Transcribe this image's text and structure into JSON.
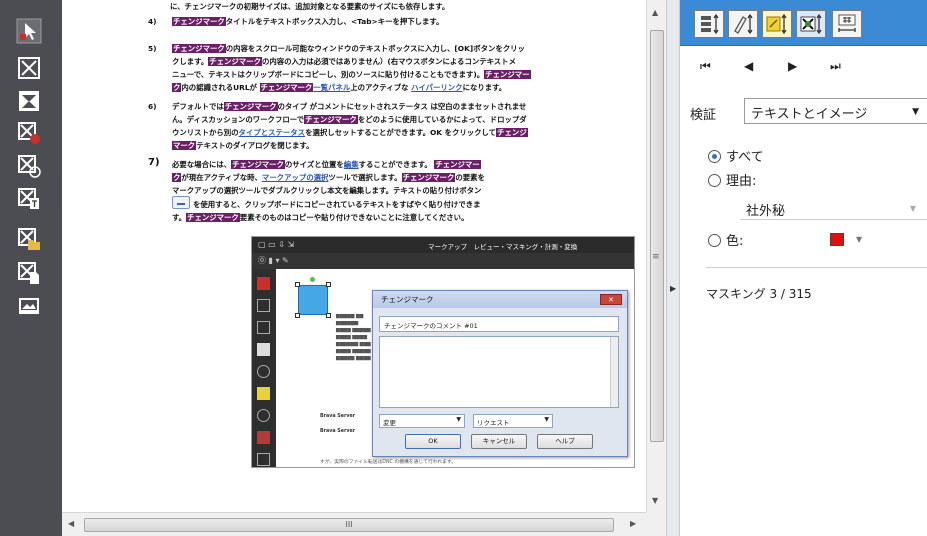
{
  "document": {
    "line_top": "に、チェンジマークの初期サイズは、追加対象となる要素のサイズにも依存します。",
    "item4": {
      "number": "4)",
      "hl": "チェンジマーク",
      "text": "タイトルをテキストボックス入力し、<Tab>キーを押下します。"
    },
    "item5": {
      "number": "5)",
      "hl1": "チェンジマーク",
      "t1": "の内容をスクロール可能なウィンドウのテキストボックスに入力し、[OK]ボタンをクリッ",
      "t2a": "クします。",
      "hl2": "チェンジマーク",
      "t2b": "の内容の入力は必須ではありません）(右マウスボタンによるコンテキストメ",
      "t3a": "ニューで、テキストはクリップボードにコピーし、別のソースに貼り付けることもできます)。",
      "hl3": "チェンジマー",
      "hl4": "ク",
      "t4a": "内の認識されるURLが",
      "hl5": "チェンジマーク",
      "lnk1": "一覧パネル",
      "t4b": "上のアクティブな",
      "lnk2": "ハイパーリンク",
      "t4c": "になります。"
    },
    "item6": {
      "number": "6)",
      "t1a": "デフォルトでは",
      "hl1": "チェンジマーク",
      "t1b": "のタイプ がコメントにセットされステータス は空白のままセットされませ",
      "t2a": "ん。ディスカッションのワークフローで",
      "hl2": "チェンジマーク",
      "t2b": "をどのように使用しているかによって、ドロップダ",
      "t3a": "ウンリストから別の",
      "lnk1": "タイプとステータス",
      "t3b": "を選択しセットすることができます。OK をクリックして",
      "hl3": "チェンジ",
      "hl4": "マーク",
      "t4": "テキストのダイアログを閉じます。"
    },
    "item7": {
      "number": "7)",
      "t1a": "必要な場合には、",
      "hl1": "チェンジマーク",
      "t1b": "のサイズと位置を",
      "lnk1": "編集",
      "t1c": "することができます。",
      "hl2": "チェンジマー",
      "hl3": "ク",
      "t2a": "が現在アクティブな時、",
      "lnk2": "マークアップの選択",
      "t2b": "ツールで選択します。",
      "hl4": "チェンジマーク",
      "t2c": "の要素を",
      "t3": "マークアップの選択ツールでダブルクリックし本文を編集します。テキストの貼り付けボタン",
      "t4": "を使用すると、クリップボードにコピーされているテキストをすばやく貼り付けできま",
      "t5a": "す。",
      "hl5": "チェンジマーク",
      "t5b": "要素そのものはコピーや貼り付けできないことに注意してください。"
    }
  },
  "embedded": {
    "menubar": "マークアップ　レビュー・マスキング・計測・変換",
    "side_text_1": "Brava Server",
    "side_text_2": "Brava Server",
    "bottom_text": "すが、実際のファイル転送はDNC の機構を通じて行われます。",
    "dialog": {
      "title": "チェンジマーク",
      "comment_value": "チェンジマークのコメント #01",
      "type_select": "変更",
      "status_select": "リクエスト",
      "ok_label": "OK",
      "cancel_label": "キャンセル",
      "help_label": "ヘルプ"
    }
  },
  "scrollbar": {
    "h_thumb_grip": "III"
  },
  "right_panel": {
    "nav": {
      "first": "⏮",
      "prev": "◀",
      "next": "▶",
      "last": "⏭"
    },
    "verify_label": "検証",
    "verify_value": "テキストとイメージ",
    "radio_all": "すべて",
    "radio_reason": "理由:",
    "reason_value": "社外秘",
    "radio_color": "色:",
    "color_value": "#e01010",
    "mask_count": "マスキング 3 / 315"
  },
  "icons": [
    "redact-pointer-icon",
    "redact-area-icon",
    "redact-region-icon",
    "redact-reason-icon",
    "redact-text-icon",
    "redact-page-icon",
    "redact-folder-icon",
    "redact-file-icon",
    "redact-image-icon"
  ]
}
